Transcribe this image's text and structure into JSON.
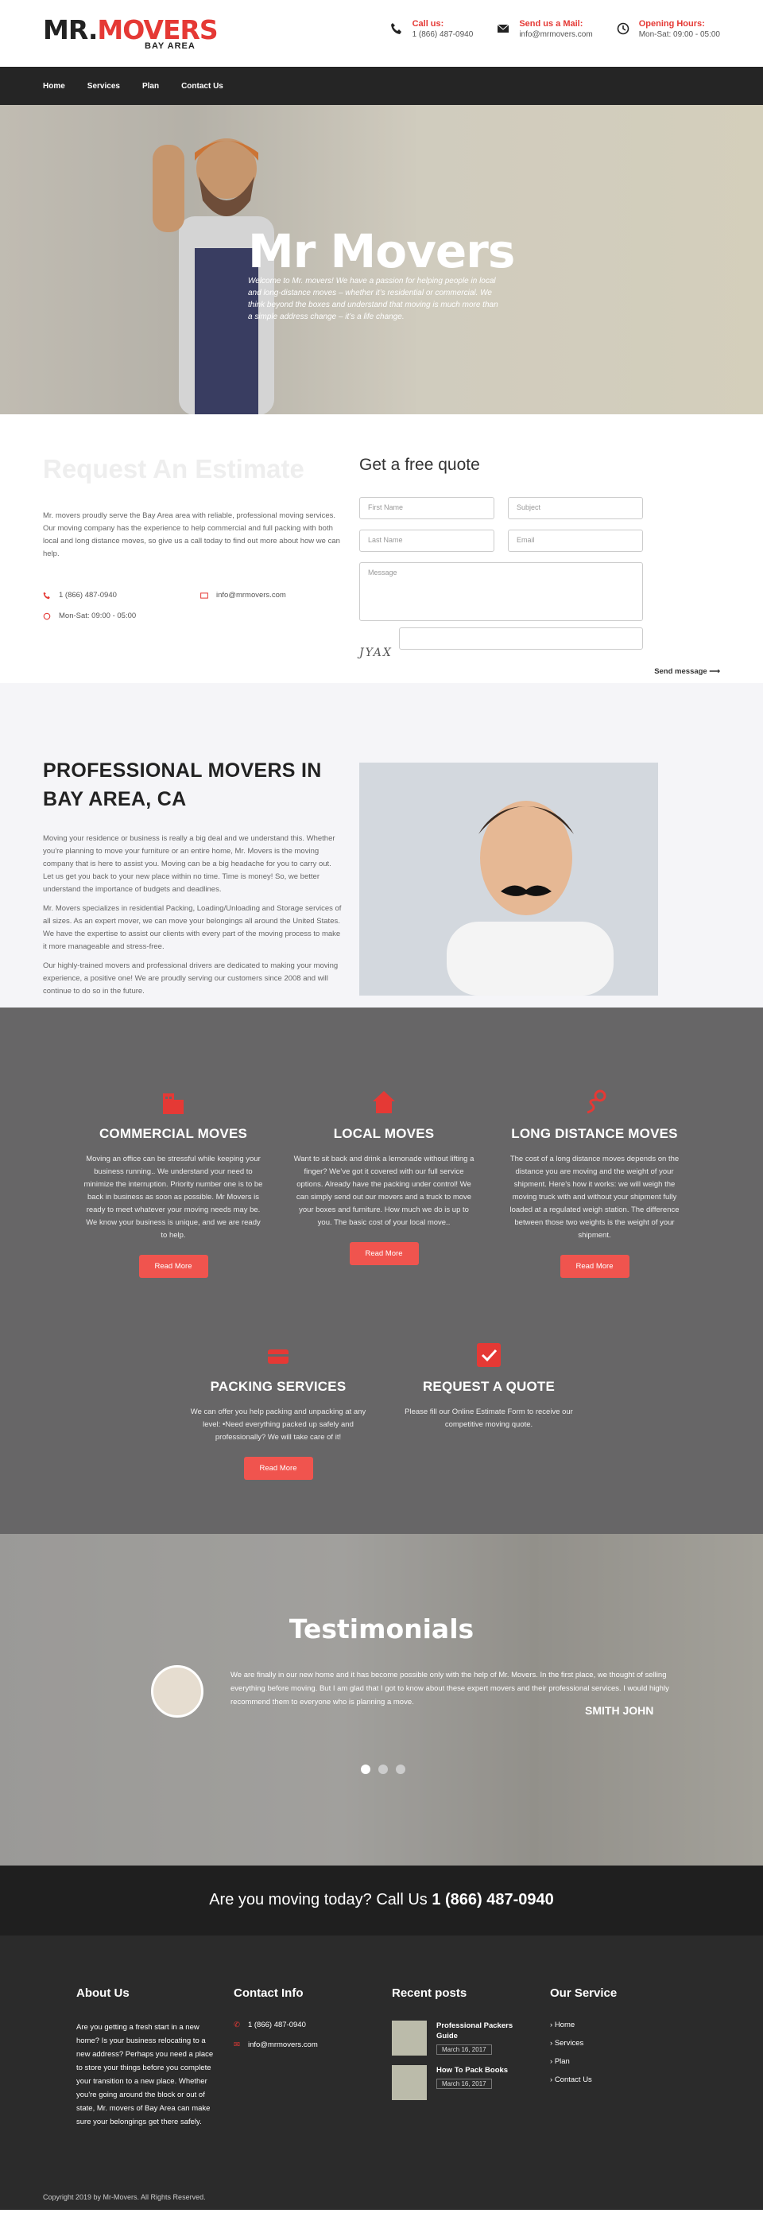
{
  "brand": {
    "part1": "MR.",
    "part2": "MOVERS",
    "sub": "BAY AREA"
  },
  "header": {
    "call_label": "Call us:",
    "call_value": "1 (866) 487-0940",
    "mail_label": "Send us a Mail:",
    "mail_value": "info@mrmovers.com",
    "hours_label": "Opening Hours:",
    "hours_value": "Mon-Sat: 09:00 - 05:00"
  },
  "nav": [
    "Home",
    "Services",
    "Plan",
    "Contact Us"
  ],
  "hero": {
    "title": "Mr Movers",
    "text": "Welcome to Mr. movers! We have a passion for helping people in local and long-distance moves – whether it’s residential or commercial. We think beyond the boxes and understand that moving is much more than a simple address change – it’s a life change."
  },
  "estimate": {
    "title": "Request An Estimate",
    "text": "Mr. movers proudly serve the Bay Area area with reliable, professional moving services. Our moving company has the experience to help commercial and full packing with both local and long distance moves, so give us a call today to find out more about how we can help.",
    "phone": "1 (866) 487-0940",
    "email": "info@mrmovers.com",
    "hours": "Mon-Sat: 09:00 - 05:00",
    "form_title": "Get a free quote",
    "first": "First Name",
    "subject": "Subject",
    "last": "Last Name",
    "email_ph": "Email",
    "message": "Message",
    "captcha": "JYAX",
    "send": "Send message"
  },
  "pro": {
    "title": "PROFESSIONAL MOVERS IN BAY AREA, CA",
    "p1": "Moving your residence or business is really a big deal and we understand this. Whether you're planning to move your furniture or an entire home, Mr. Movers is the moving company that is here to assist you. Moving can be a big headache for you to carry out. Let us get you back to your new place within no time. Time is money! So, we better understand the importance of budgets and deadlines.",
    "p2": "Mr. Movers specializes in residential Packing, Loading/Unloading and Storage services of all sizes. As an expert mover, we can move your belongings all around the United States. We have the expertise to assist our clients with every part of the moving process to make it more manageable and stress-free.",
    "p3": "Our highly-trained movers and professional drivers are dedicated to making your moving experience, a positive one! We are proudly serving our customers since 2008 and will continue to do so in the future."
  },
  "services": [
    {
      "title": "COMMERCIAL MOVES",
      "text": "Moving an office can be stressful while keeping your business running.. We understand your need to minimize the interruption. Priority number one is to be back in business as soon as possible. Mr Movers is ready to meet whatever your moving needs may be. We know your business is unique, and we are ready to help.",
      "btn": "Read More"
    },
    {
      "title": "LOCAL MOVES",
      "text": "Want to sit back and drink a lemonade without lifting a finger? We’ve got it covered with our full service options. Already have the packing under control! We can simply send out our movers and a truck to move your boxes and furniture. How much we do is up to you. The basic cost of your local move..",
      "btn": "Read More"
    },
    {
      "title": "LONG DISTANCE MOVES",
      "text": "The cost of a long distance moves depends on the distance you are moving and the weight of your shipment. Here’s how it works: we will weigh the moving truck with and without your shipment fully loaded at a regulated weigh station. The difference between those two weights is the weight of your shipment.",
      "btn": "Read More"
    },
    {
      "title": "PACKING SERVICES",
      "text": "We can offer you help packing and unpacking at any level: •Need everything packed up safely and professionally? We will take care of it!",
      "btn": "Read More"
    },
    {
      "title": "REQUEST A QUOTE",
      "text": "Please fill our Online Estimate Form to receive our competitive moving quote."
    }
  ],
  "colors": {
    "accent": "#e53935",
    "button": "#f0544e",
    "services_bg": "#676667"
  },
  "testimonials": {
    "title": "Testimonials",
    "quote": "We are finally in our new home and it has become possible only with the help of Mr. Movers. In the first place, we thought of selling everything before moving. But I am glad that I got to know about these expert movers and their professional services. I would highly recommend them to everyone who is planning a move.",
    "author": "SMITH JOHN"
  },
  "cta": {
    "text": "Are you moving today? Call Us ",
    "phone": "1 (866) 487-0940"
  },
  "footer": {
    "about_title": "About Us",
    "about_text": "Are you getting a fresh start in a new home? Is your business relocating to a new address? Perhaps you need a place to store your things before you complete your transition to a new place. Whether you're going around the block or out of state, Mr. movers of Bay Area can make sure your belongings get there safely.",
    "contact_title": "Contact Info",
    "phone": "1 (866) 487-0940",
    "email": "info@mrmovers.com",
    "posts_title": "Recent posts",
    "posts": [
      {
        "title": "Professional Packers Guide",
        "date": "March 16, 2017"
      },
      {
        "title": "How To Pack Books",
        "date": "March 16, 2017"
      }
    ],
    "service_title": "Our Service",
    "service_links": [
      "Home",
      "Services",
      "Plan",
      "Contact Us"
    ],
    "copyright": "Copyright 2019 by Mr-Movers. All Rights Reserved."
  }
}
